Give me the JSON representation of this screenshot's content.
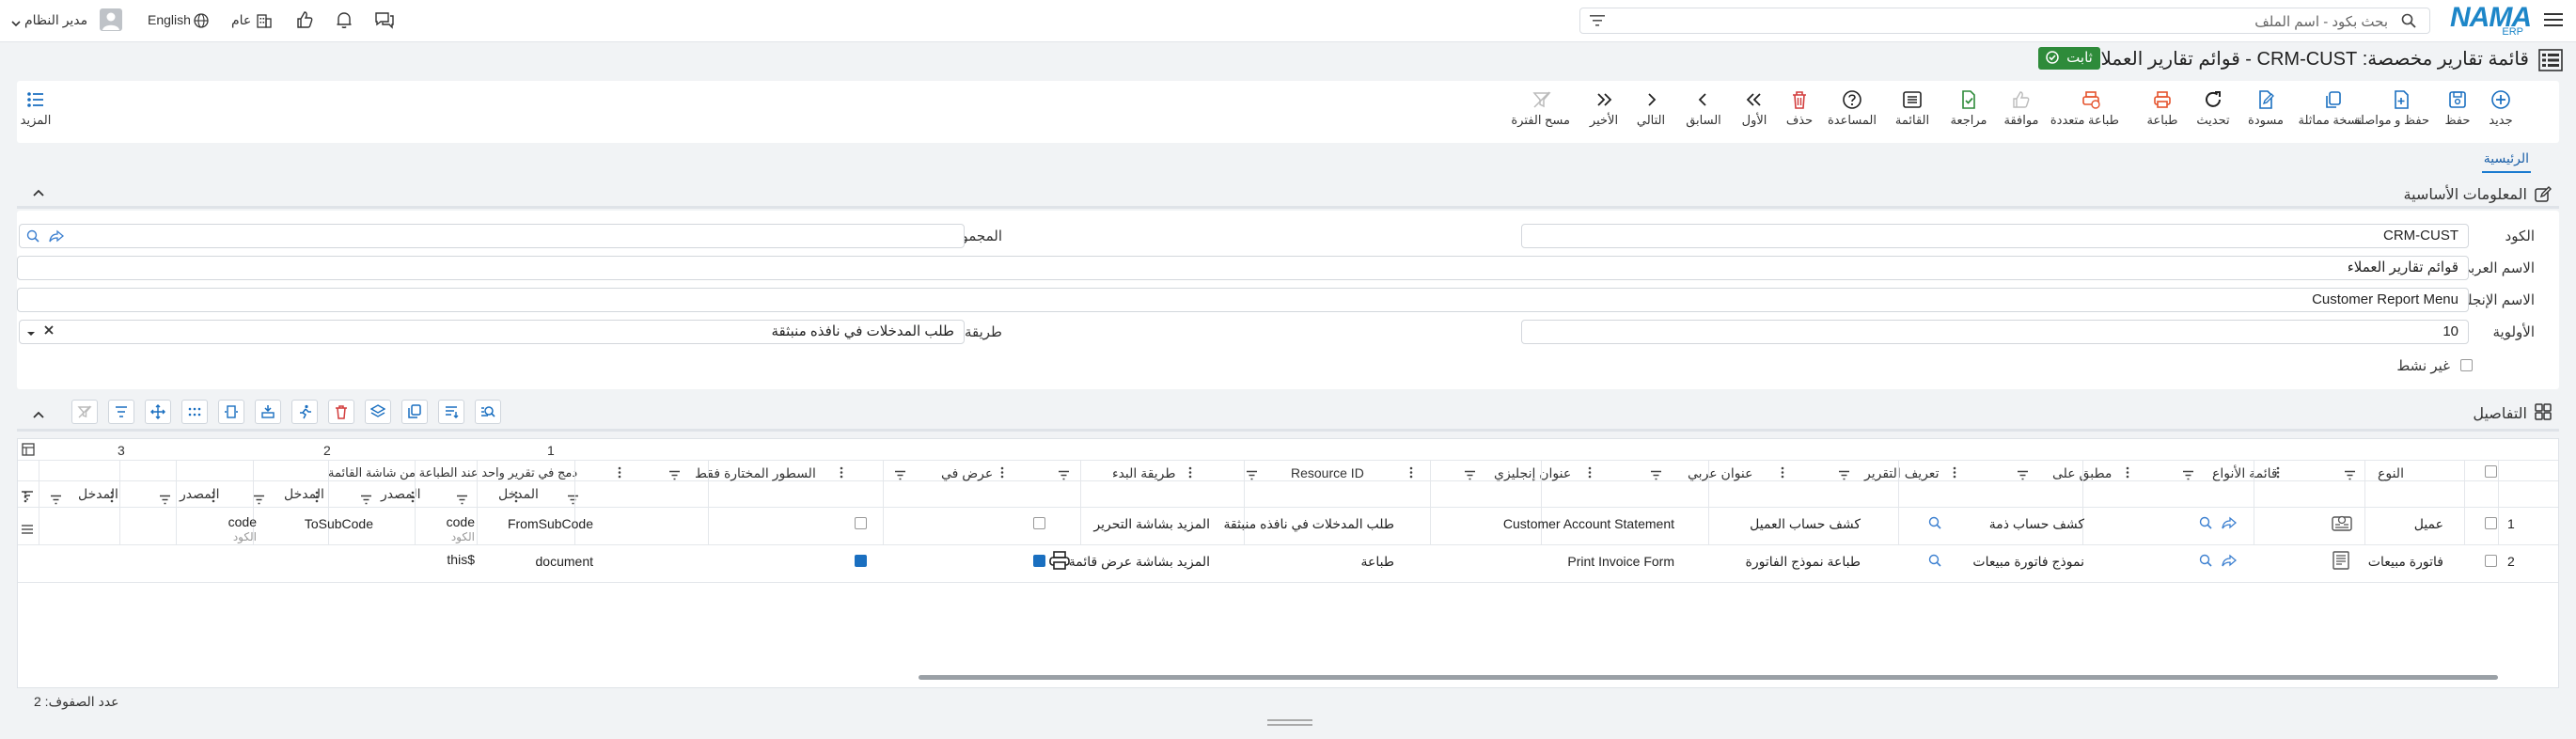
{
  "header": {
    "search_placeholder": "بحث بكود - اسم الملف",
    "logo_main": "NAMA",
    "logo_sub": "ERP",
    "user_name": "مدير النظام",
    "language": "English",
    "scope": "عام"
  },
  "title": {
    "text": "قائمة تقارير مخصصة: CRM-CUST - قوائم تقارير العملاء",
    "badge": "ثابت"
  },
  "toolbar": {
    "buttons": [
      {
        "label": "جديد",
        "icon": "plus-circle-icon",
        "color": "#1a6fc0"
      },
      {
        "label": "حفظ",
        "icon": "save-icon",
        "color": "#1a6fc0"
      },
      {
        "label": "حفظ و مواصلة",
        "icon": "save-continue-icon",
        "color": "#1a6fc0"
      },
      {
        "label": "نسخة مماثلة",
        "icon": "copy-icon",
        "color": "#1a6fc0"
      },
      {
        "label": "مسودة",
        "icon": "draft-icon",
        "color": "#1a6fc0"
      },
      {
        "label": "تحديث",
        "icon": "refresh-icon",
        "color": "#222"
      },
      {
        "label": "طباعة",
        "icon": "print-icon",
        "color": "#e5532d"
      },
      {
        "label": "طباعة متعددة",
        "icon": "multi-print-icon",
        "color": "#e5532d"
      },
      {
        "label": "موافقة",
        "icon": "thumbs-up-icon",
        "color": "#bbb"
      },
      {
        "label": "مراجعة",
        "icon": "review-icon",
        "color": "#2e8b3a"
      },
      {
        "label": "القائمة",
        "icon": "list-icon",
        "color": "#222"
      },
      {
        "label": "المساعدة",
        "icon": "help-icon",
        "color": "#222"
      },
      {
        "label": "حذف",
        "icon": "trash-icon",
        "color": "#d23c3c"
      },
      {
        "label": "الأول",
        "icon": "first-icon",
        "color": "#222"
      },
      {
        "label": "السابق",
        "icon": "prev-icon",
        "color": "#222"
      },
      {
        "label": "التالي",
        "icon": "next-icon",
        "color": "#222"
      },
      {
        "label": "الأخير",
        "icon": "last-icon",
        "color": "#222"
      },
      {
        "label": "مسح الفترة",
        "icon": "clear-filter-icon",
        "color": "#bbb"
      }
    ],
    "more_label": "المزيد"
  },
  "tabs": {
    "main": "الرئيسية"
  },
  "basic_info": {
    "section_title": "المعلومات الأساسية",
    "code_label": "الكود",
    "code_value": "CRM-CUST",
    "arabic_name_label": "الاسم العربي",
    "arabic_name_value": "قوائم تقارير العملاء",
    "english_name_label": "الاسم الإنجليزي",
    "english_name_value": "Customer Report Menu",
    "priority_label": "الأولوية",
    "priority_value": "10",
    "inactive_label": "غير نشط",
    "group_label": "المجموعة",
    "group_value": "",
    "start_method_label": "طريقة البدء",
    "start_method_value": "طلب المدخلات في نافذه منبثقة"
  },
  "details": {
    "section_title": "التفاصيل",
    "group_headers": [
      "1",
      "2",
      "3"
    ],
    "columns": {
      "type": "النوع",
      "types_list": "قائمة الأنواع",
      "applied_on": "مطبق على",
      "report_def": "تعريف التقرير",
      "ar_title": "عنوان عربي",
      "en_title": "عنوان إنجليزي",
      "resource_id": "Resource ID",
      "start_method": "طريقة البدء",
      "display_in": "عرض في",
      "selected_rows": "السطور المختارة فقط",
      "merge": "دمج في تقرير واحد عند الطباعة من شاشة القائمة",
      "input": "المدخل",
      "source": "المصدر"
    },
    "rows": [
      {
        "num": "1",
        "type": "عميل",
        "report_def": "كشف حساب ذمة",
        "ar_title": "كشف حساب العميل",
        "en_title": "Customer Account Statement",
        "start_method": "طلب المدخلات في نافذه منبثقة",
        "display_in": "المزيد بشاشة التحرير",
        "selected_rows": false,
        "merge": false,
        "in1": "FromSubCode",
        "src1": "code",
        "src1_sub": "الكود",
        "in2": "ToSubCode",
        "src2": "code",
        "src2_sub": "الكود",
        "in3": ""
      },
      {
        "num": "2",
        "type": "فاتورة مبيعات",
        "report_def": "نموذج فاتورة مبيعات",
        "ar_title": "طباعة نموذج الفاتورة",
        "en_title": "Print Invoice Form",
        "start_method": "طباعة",
        "display_in": "المزيد بشاشة عرض قائمة",
        "selected_rows": true,
        "merge": true,
        "in1": "document",
        "src1": "$this",
        "src1_sub": "",
        "in2": "",
        "src2": "",
        "src2_sub": "",
        "in3": ""
      }
    ],
    "row_count": "عدد الصفوف: 2"
  }
}
